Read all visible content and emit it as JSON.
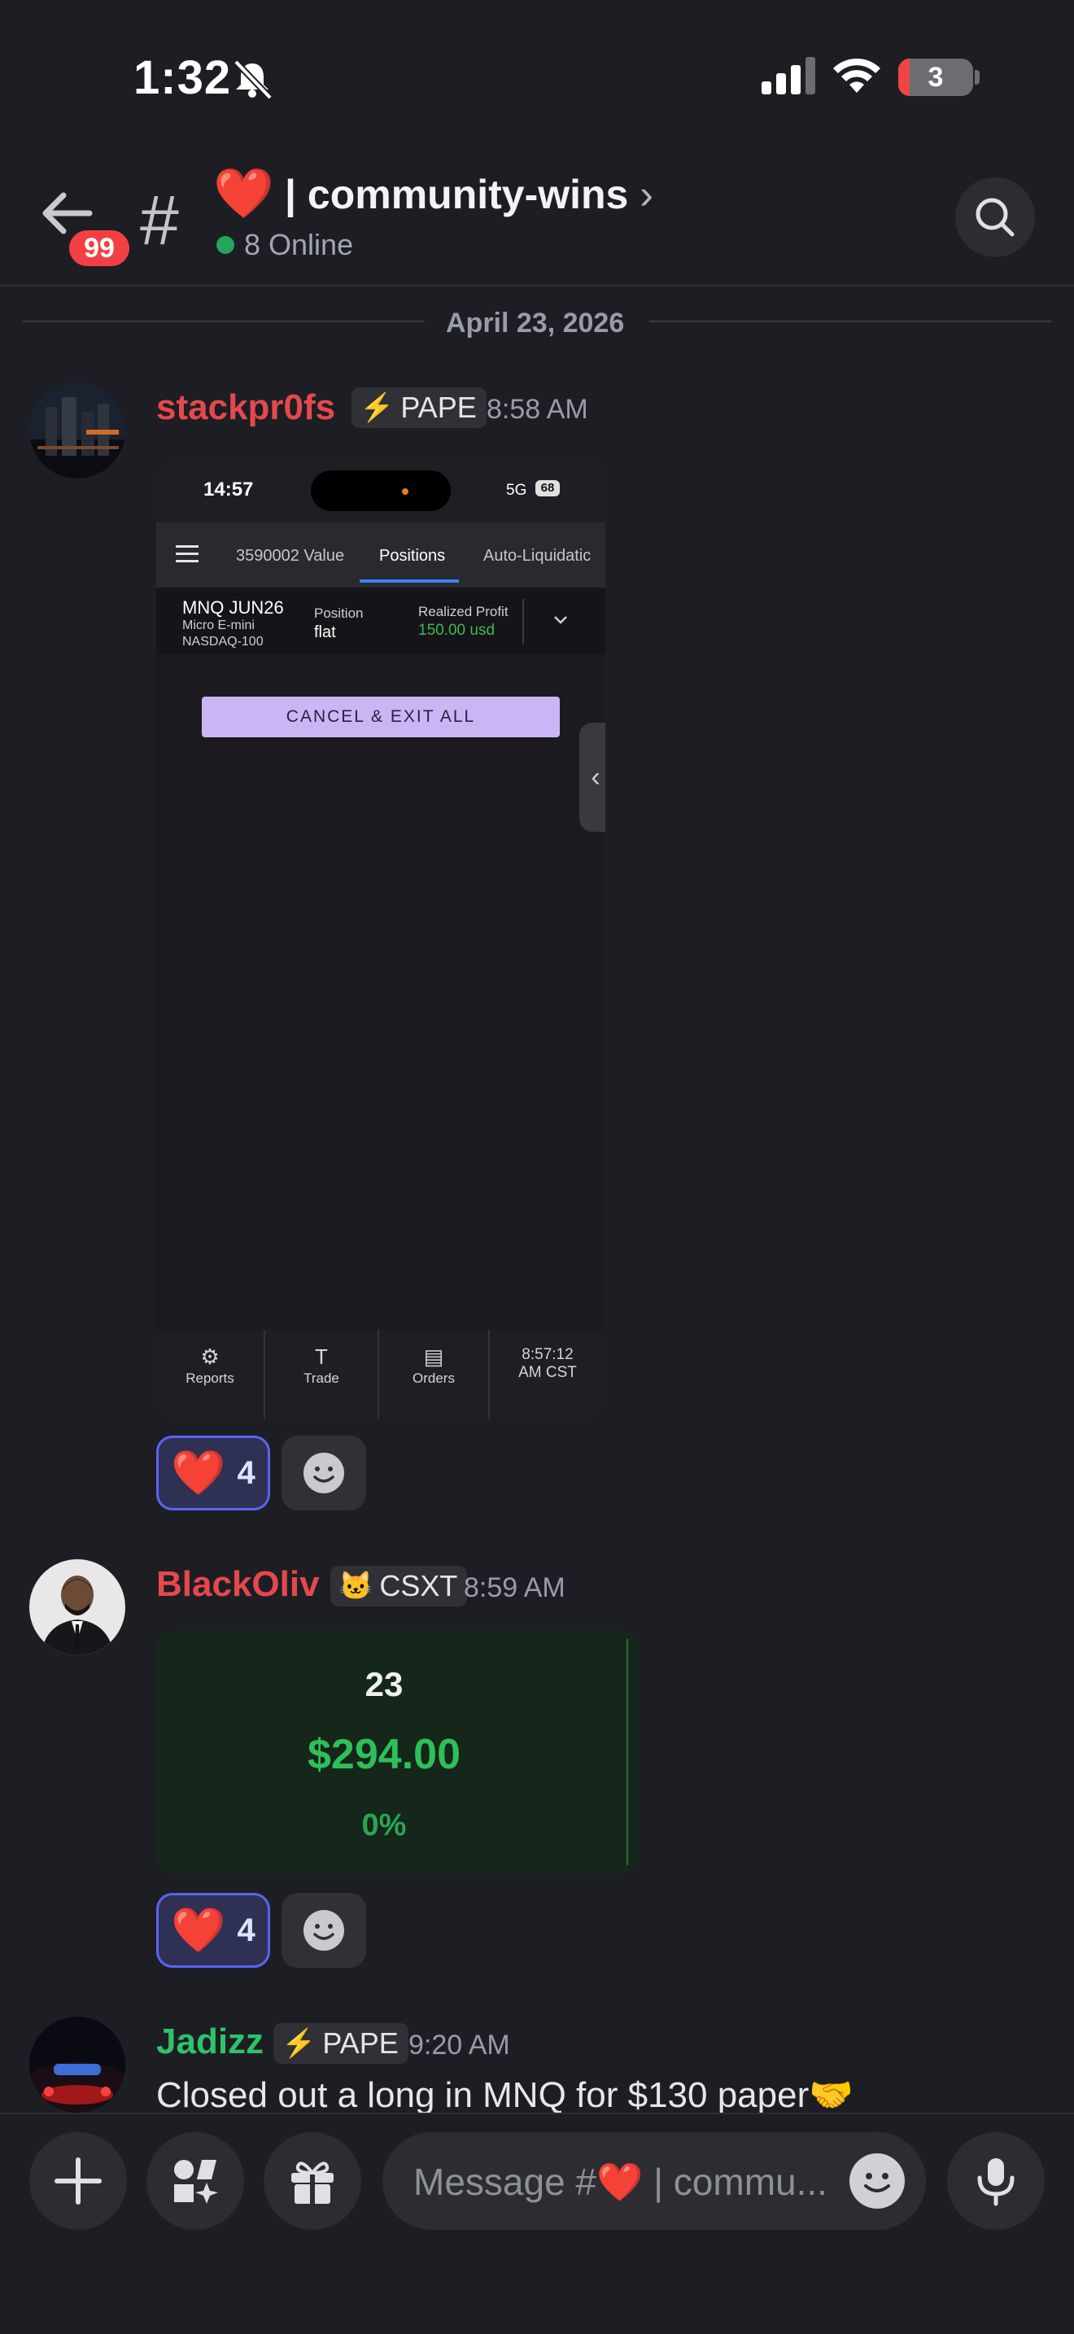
{
  "status": {
    "time": "1:32",
    "battery": "3"
  },
  "header": {
    "badge": "99",
    "hash": "#",
    "channel_emoji": "❤️",
    "channel_name": "| community-wins",
    "chevron": "›",
    "online": "8 Online"
  },
  "date_divider": "April 23, 2026",
  "messages": [
    {
      "author": "stackpr0fs",
      "author_color": "#e5484d",
      "tag_icon": "⚡",
      "tag": "PAPE",
      "time": "8:58 AM",
      "attachment": {
        "time": "14:57",
        "network": "5G",
        "battery": "68",
        "tabs": [
          "3590002 Value",
          "Positions",
          "Auto-Liquidatic"
        ],
        "instrument": "MNQ JUN26",
        "instrument_desc1": "Micro E-mini",
        "instrument_desc2": "NASDAQ-100",
        "position_label": "Position",
        "position_value": "flat",
        "profit_label": "Realized Profit",
        "profit_value": "150.00 usd",
        "cancel_label": "CANCEL & EXIT ALL",
        "bottom_nav": [
          {
            "icon": "gear-icon",
            "glyph": "⚙",
            "label": "Reports"
          },
          {
            "icon": "trade-icon",
            "glyph": "T",
            "label": "Trade"
          },
          {
            "icon": "orders-icon",
            "glyph": "▤",
            "label": "Orders"
          }
        ],
        "clock_line1": "8:57:12",
        "clock_line2": "AM CST"
      },
      "reaction": {
        "emoji": "❤️",
        "count": "4"
      }
    },
    {
      "author": "BlackOliv",
      "author_color": "#e5484d",
      "tag_icon": "🐱",
      "tag": "CSXT",
      "time": "8:59 AM",
      "card": {
        "count": "23",
        "amount": "$294.00",
        "percent": "0%"
      },
      "reaction": {
        "emoji": "❤️",
        "count": "4"
      }
    },
    {
      "author": "Jadizz",
      "author_color": "#2dc26b",
      "tag_icon": "⚡",
      "tag": "PAPE",
      "time": "9:20 AM",
      "text": "Closed out a long in MNQ for $130 paper🤝"
    }
  ],
  "composer": {
    "placeholder": "Message #❤️ | commu..."
  }
}
